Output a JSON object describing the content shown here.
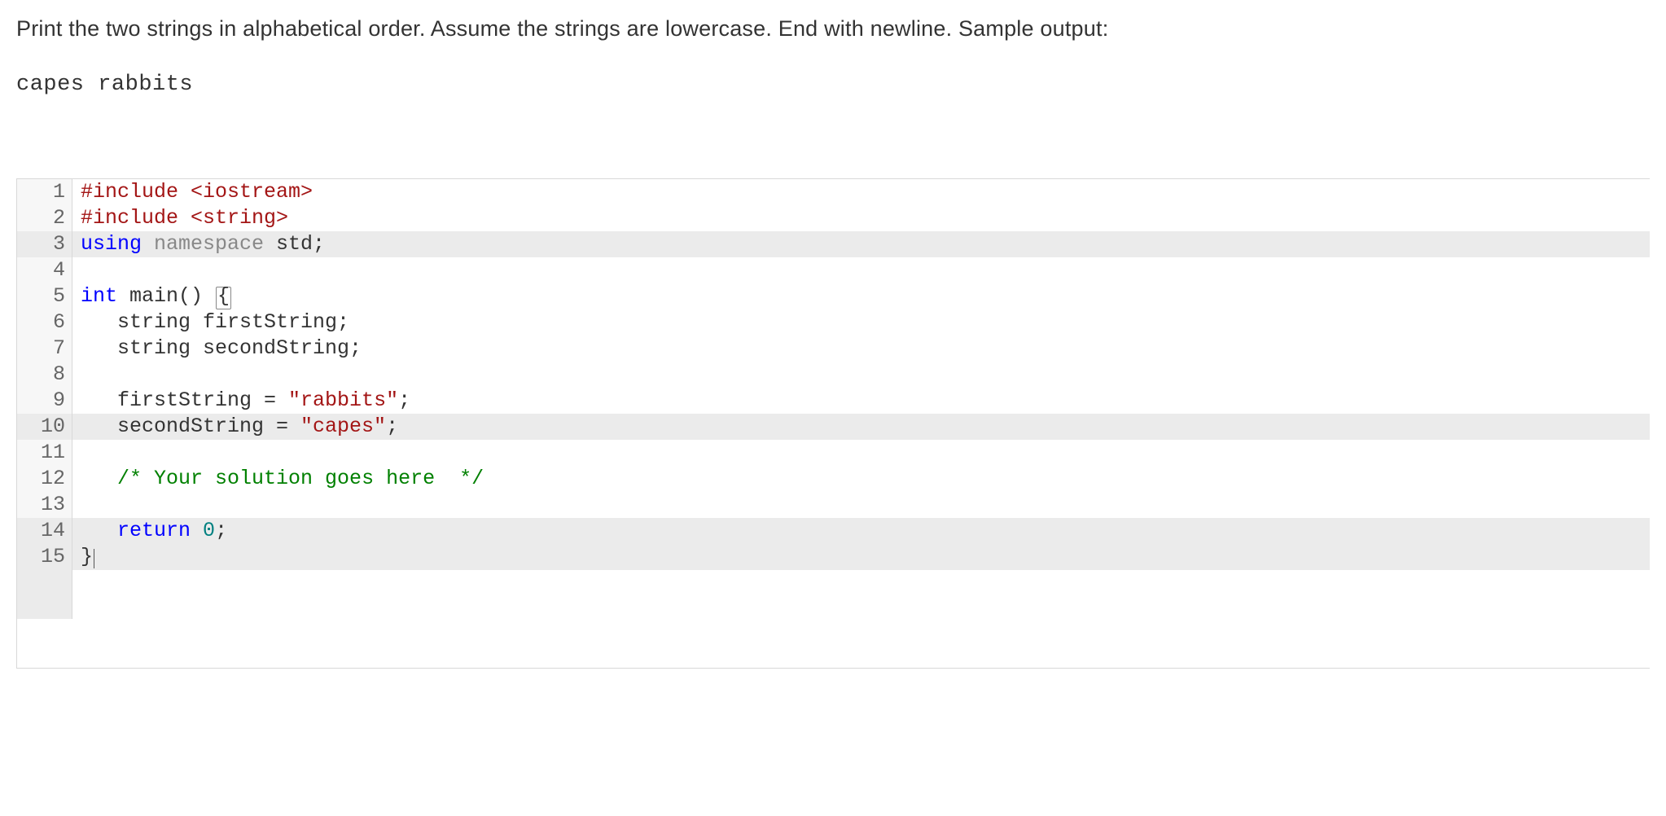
{
  "prompt": "Print the two strings in alphabetical order. Assume the strings are lowercase. End with newline. Sample output:",
  "sample_output": "capes rabbits",
  "code": {
    "lines": [
      {
        "n": 1,
        "hl": false,
        "tokens": [
          {
            "t": "#include ",
            "c": "tok-pp"
          },
          {
            "t": "<iostream>",
            "c": "tok-pp"
          }
        ]
      },
      {
        "n": 2,
        "hl": false,
        "tokens": [
          {
            "t": "#include ",
            "c": "tok-pp"
          },
          {
            "t": "<string>",
            "c": "tok-pp"
          }
        ]
      },
      {
        "n": 3,
        "hl": true,
        "tokens": [
          {
            "t": "using ",
            "c": "tok-kw"
          },
          {
            "t": "namespace ",
            "c": "tok-kw2"
          },
          {
            "t": "std;",
            "c": "tok-plain"
          }
        ]
      },
      {
        "n": 4,
        "hl": false,
        "tokens": [
          {
            "t": "",
            "c": "tok-plain"
          }
        ]
      },
      {
        "n": 5,
        "hl": false,
        "tokens": [
          {
            "t": "int ",
            "c": "tok-kw"
          },
          {
            "t": "main() ",
            "c": "tok-plain"
          },
          {
            "t": "{",
            "c": "tok-plain",
            "boxed": true
          }
        ]
      },
      {
        "n": 6,
        "hl": false,
        "tokens": [
          {
            "t": "   string firstString;",
            "c": "tok-plain"
          }
        ]
      },
      {
        "n": 7,
        "hl": false,
        "tokens": [
          {
            "t": "   string secondString;",
            "c": "tok-plain"
          }
        ]
      },
      {
        "n": 8,
        "hl": false,
        "tokens": [
          {
            "t": "",
            "c": "tok-plain"
          }
        ]
      },
      {
        "n": 9,
        "hl": false,
        "tokens": [
          {
            "t": "   firstString = ",
            "c": "tok-plain"
          },
          {
            "t": "\"rabbits\"",
            "c": "tok-str"
          },
          {
            "t": ";",
            "c": "tok-plain"
          }
        ]
      },
      {
        "n": 10,
        "hl": true,
        "tokens": [
          {
            "t": "   secondString = ",
            "c": "tok-plain"
          },
          {
            "t": "\"capes\"",
            "c": "tok-str"
          },
          {
            "t": ";",
            "c": "tok-plain"
          }
        ]
      },
      {
        "n": 11,
        "hl": false,
        "tokens": [
          {
            "t": "",
            "c": "tok-plain"
          }
        ]
      },
      {
        "n": 12,
        "hl": false,
        "tokens": [
          {
            "t": "   ",
            "c": "tok-plain"
          },
          {
            "t": "/* Your solution goes here  */",
            "c": "tok-com"
          }
        ]
      },
      {
        "n": 13,
        "hl": false,
        "tokens": [
          {
            "t": "",
            "c": "tok-plain"
          }
        ]
      },
      {
        "n": 14,
        "hl": true,
        "tokens": [
          {
            "t": "   ",
            "c": "tok-plain"
          },
          {
            "t": "return ",
            "c": "tok-kw"
          },
          {
            "t": "0",
            "c": "tok-num"
          },
          {
            "t": ";",
            "c": "tok-plain"
          }
        ]
      },
      {
        "n": 15,
        "hl": true,
        "tokens": [
          {
            "t": "}",
            "c": "tok-plain",
            "cursor_after": true
          }
        ]
      }
    ]
  }
}
